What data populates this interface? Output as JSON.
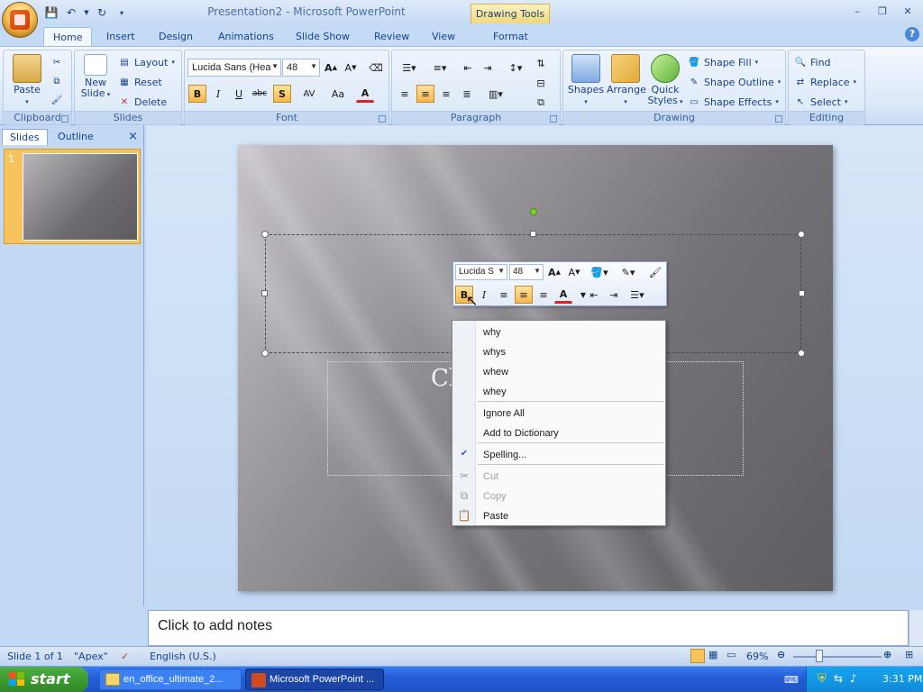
{
  "window": {
    "title": "Presentation2 - Microsoft PowerPoint",
    "contextual_tab_group": "Drawing Tools",
    "controls": [
      "–",
      "❐",
      "✕"
    ]
  },
  "ribbon_tabs": [
    "Home",
    "Insert",
    "Design",
    "Animations",
    "Slide Show",
    "Review",
    "View",
    "Format"
  ],
  "active_tab": "Home",
  "ribbon": {
    "clipboard": {
      "label": "Clipboard",
      "paste": "Paste"
    },
    "slides": {
      "label": "Slides",
      "new_slide_1": "New",
      "new_slide_2": "Slide",
      "layout": "Layout",
      "reset": "Reset",
      "delete": "Delete"
    },
    "font": {
      "label": "Font",
      "font_name": "Lucida Sans (Hea",
      "font_size": "48",
      "bold": "B",
      "italic": "I",
      "underline": "U",
      "strike": "abc",
      "shadow": "S",
      "spacing": "AV",
      "case": "Aa",
      "color": "A"
    },
    "paragraph": {
      "label": "Paragraph"
    },
    "drawing": {
      "label": "Drawing",
      "shapes": "Shapes",
      "arrange": "Arrange",
      "quick_styles_1": "Quick",
      "quick_styles_2": "Styles",
      "shape_fill": "Shape Fill",
      "shape_outline": "Shape Outline",
      "shape_effects": "Shape Effects"
    },
    "editing": {
      "label": "Editing",
      "find": "Find",
      "replace": "Replace",
      "select": "Select"
    }
  },
  "pane": {
    "tab_slides": "Slides",
    "tab_outline": "Outline",
    "close": "×",
    "slide_number": "1"
  },
  "slide": {
    "subtitle_partial": "Cl"
  },
  "mini_toolbar": {
    "font": "Lucida S",
    "size": "48",
    "bold": "B",
    "italic": "I",
    "color": "A"
  },
  "context_menu": {
    "suggestions": [
      "why",
      "whys",
      "whew",
      "whey"
    ],
    "ignore_all": "Ignore All",
    "add_to_dictionary": "Add to Dictionary",
    "spelling": "Spelling...",
    "cut": "Cut",
    "copy": "Copy",
    "paste": "Paste"
  },
  "notes": {
    "placeholder": "Click to add notes"
  },
  "status": {
    "slide": "Slide 1 of 1",
    "theme": "\"Apex\"",
    "language": "English (U.S.)",
    "zoom": "69%"
  },
  "taskbar": {
    "start": "start",
    "task1": "en_office_ultimate_2...",
    "task2": "Microsoft PowerPoint ...",
    "clock": "3:31 PM"
  },
  "colors": {
    "accent_orange": "#f7b649",
    "ribbon_blue": "#15428b",
    "taskbar_blue": "#245ed9"
  }
}
